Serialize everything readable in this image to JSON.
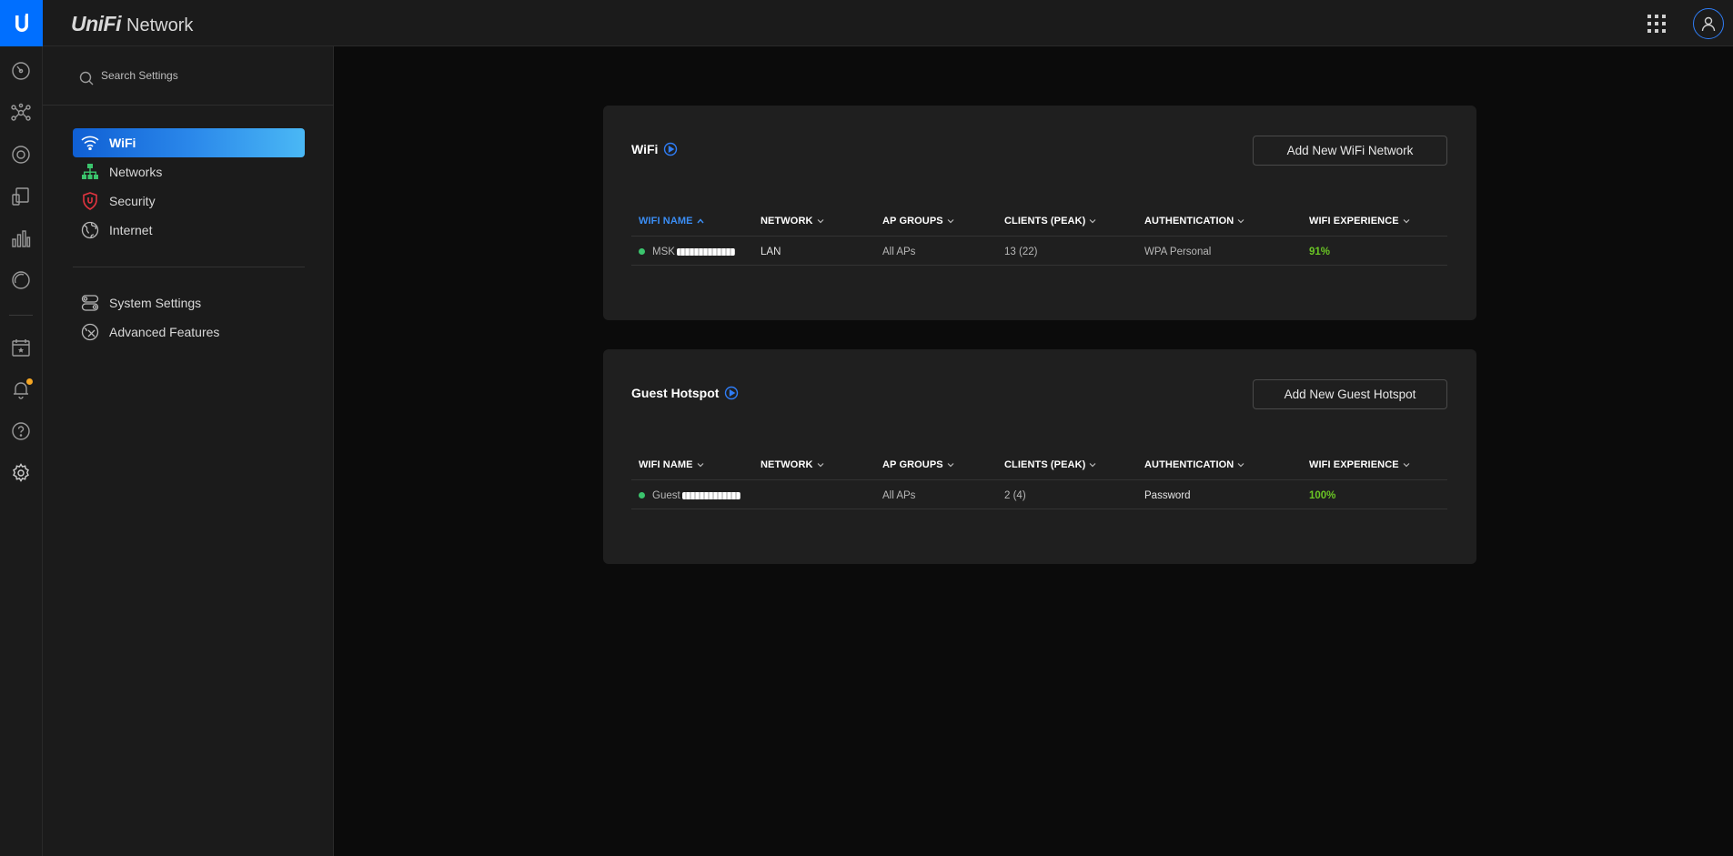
{
  "app": {
    "brand_unifi": "UniFi",
    "brand_network": "Network",
    "accent": "#006fff"
  },
  "rail": {
    "icons": [
      "dashboard-icon",
      "topology-icon",
      "devices-icon",
      "clients-icon",
      "statistics-icon",
      "insights-icon",
      "events-icon",
      "notifications-icon",
      "help-icon",
      "settings-icon"
    ],
    "notification_color": "#f5a623"
  },
  "sidebar": {
    "search_placeholder": "Search Settings",
    "items": [
      {
        "label": "WiFi",
        "icon": "wifi-icon",
        "active": true
      },
      {
        "label": "Networks",
        "icon": "networks-icon",
        "active": false
      },
      {
        "label": "Security",
        "icon": "security-shield-icon",
        "active": false
      },
      {
        "label": "Internet",
        "icon": "globe-icon",
        "active": false
      }
    ],
    "items2": [
      {
        "label": "System Settings",
        "icon": "system-settings-icon"
      },
      {
        "label": "Advanced Features",
        "icon": "advanced-features-icon"
      }
    ]
  },
  "wifi_card": {
    "title": "WiFi",
    "button": "Add New WiFi Network",
    "columns": [
      "WIFI NAME",
      "NETWORK",
      "AP GROUPS",
      "CLIENTS (PEAK)",
      "AUTHENTICATION",
      "WIFI EXPERIENCE"
    ],
    "sorted_column": "WIFI NAME",
    "rows": [
      {
        "name": "MSK",
        "network": "LAN",
        "ap_groups": "All APs",
        "clients": "13 (22)",
        "auth": "WPA Personal",
        "experience": "91%"
      }
    ]
  },
  "guest_card": {
    "title": "Guest Hotspot",
    "button": "Add New Guest Hotspot",
    "columns": [
      "WIFI NAME",
      "NETWORK",
      "AP GROUPS",
      "CLIENTS (PEAK)",
      "AUTHENTICATION",
      "WIFI EXPERIENCE"
    ],
    "rows": [
      {
        "name": "Guest",
        "network": "",
        "ap_groups": "All APs",
        "clients": "2 (4)",
        "auth": "Password",
        "experience": "100%"
      }
    ]
  },
  "colors": {
    "status_online": "#3bc46d",
    "experience_good": "#6ac524",
    "sorted_header": "#3b8ef5"
  }
}
